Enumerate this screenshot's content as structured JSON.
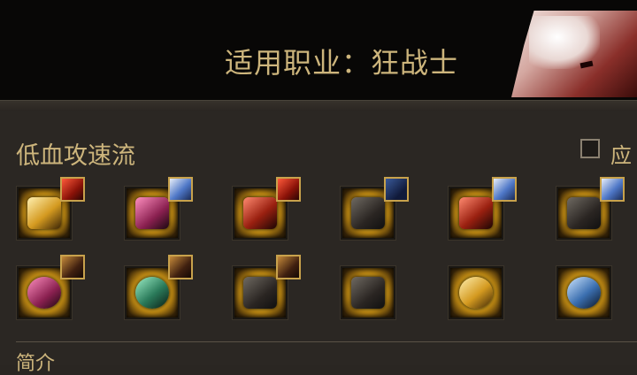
{
  "header": {
    "title": "适用职业：狂战士",
    "portrait_icon": "berserker-portrait"
  },
  "section": {
    "title": "低血攻速流",
    "checkbox_label": "应",
    "checkbox_checked": false
  },
  "equipment": {
    "row1": [
      {
        "item_icon": "weapon-greatsword-icon",
        "badge_icon": "red-emblem-icon"
      },
      {
        "item_icon": "shoulder-armor-icon",
        "badge_icon": "blue-crystal-icon"
      },
      {
        "item_icon": "chest-armor-icon",
        "badge_icon": "red-emblem-icon"
      },
      {
        "item_icon": "pants-armor-icon",
        "badge_icon": "navy-emblem-icon"
      },
      {
        "item_icon": "belt-armor-icon",
        "badge_icon": "blue-crystal-icon"
      },
      {
        "item_icon": "boots-armor-icon",
        "badge_icon": "blue-crystal-icon"
      }
    ],
    "row2": [
      {
        "item_icon": "bracelet-icon",
        "badge_icon": "dark-emblem-icon"
      },
      {
        "item_icon": "necklace-icon",
        "badge_icon": "dark-emblem-icon"
      },
      {
        "item_icon": "ring-icon",
        "badge_icon": "dark-emblem-icon"
      },
      {
        "item_icon": "bell-icon",
        "badge_icon": ""
      },
      {
        "item_icon": "pocket-watch-icon",
        "badge_icon": ""
      },
      {
        "item_icon": "earring-icon",
        "badge_icon": ""
      }
    ]
  },
  "bottom": {
    "partial_text": "简介"
  },
  "colors": {
    "accent_text": "#cdb57c",
    "header_bg": "#080706",
    "panel_bg": "#2b2723",
    "slot_glow": "#f2c630"
  }
}
